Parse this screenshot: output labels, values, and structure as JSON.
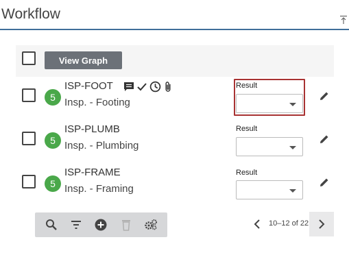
{
  "header": {
    "title": "Workflow"
  },
  "toolbar_top": {
    "view_graph_label": "View Graph"
  },
  "rows": [
    {
      "badge": "5",
      "code": "ISP-FOOT",
      "description": "Insp. - Footing",
      "result_label": "Result",
      "result_value": "",
      "icons": [
        "comment-icon",
        "check-icon",
        "clock-icon",
        "paperclip-icon"
      ]
    },
    {
      "badge": "5",
      "code": "ISP-PLUMB",
      "description": "Insp. - Plumbing",
      "result_label": "Result",
      "result_value": ""
    },
    {
      "badge": "5",
      "code": "ISP-FRAME",
      "description": "Insp. - Framing",
      "result_label": "Result",
      "result_value": ""
    }
  ],
  "bottom_toolbar": {
    "icons": [
      "search-icon",
      "filter-icon",
      "add-icon",
      "delete-icon",
      "settings-icon"
    ]
  },
  "pager": {
    "text": "10–12 of 22"
  },
  "colors": {
    "badge": "#4aa84a",
    "header_rule": "#3f6e9a",
    "focus": "#a83232",
    "button": "#6c7178"
  }
}
